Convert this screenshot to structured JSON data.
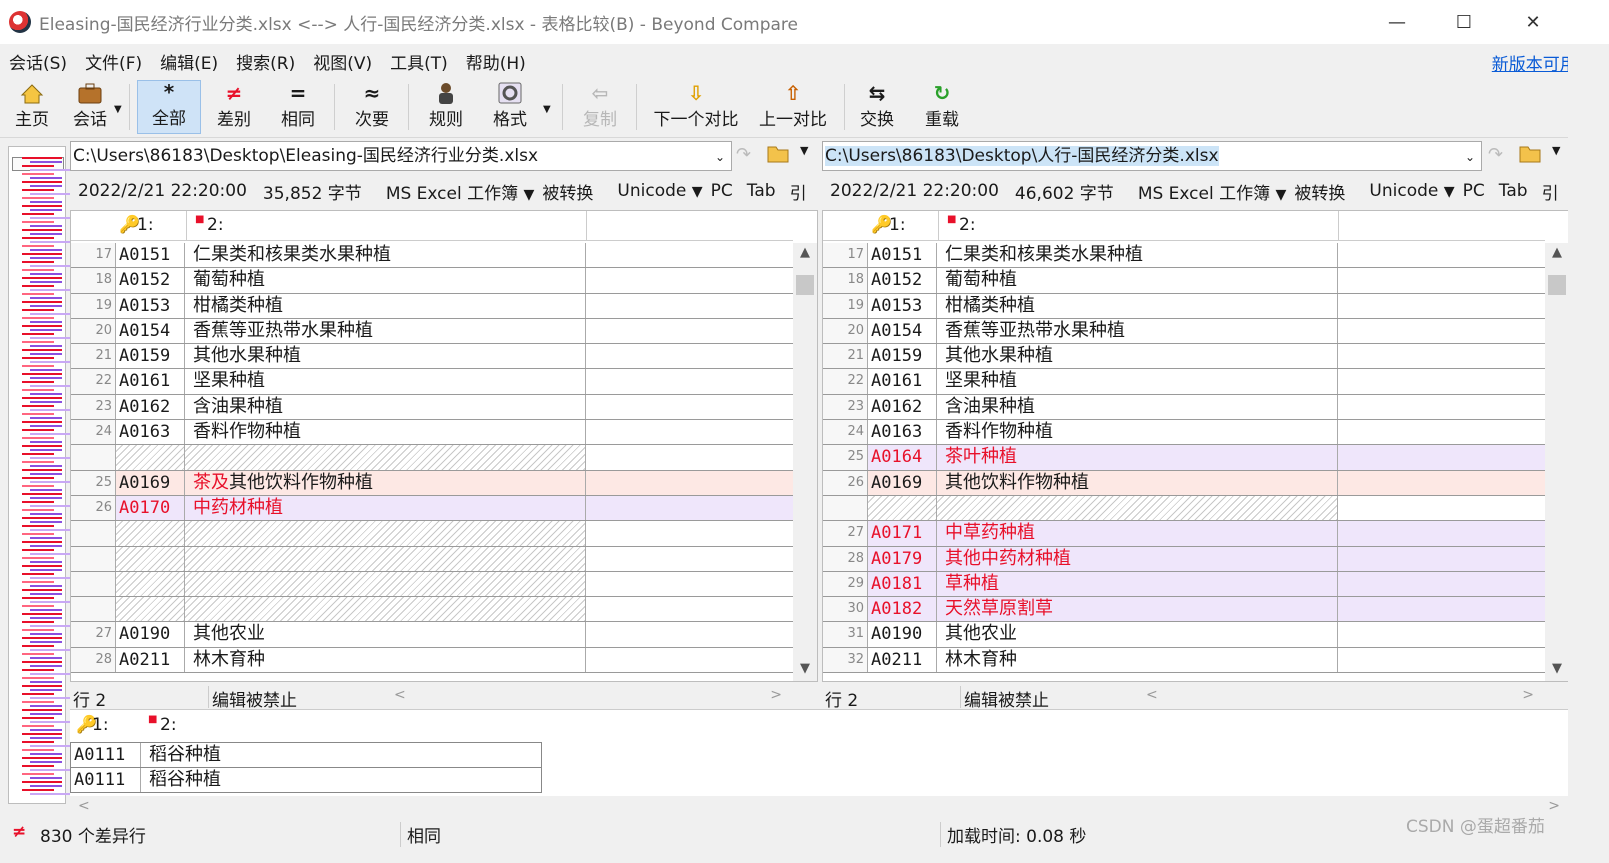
{
  "window": {
    "title": "Eleasing-国民经济行业分类.xlsx <--> 人行-国民经济分类.xlsx - 表格比较(B) - Beyond Compare"
  },
  "menu": [
    "会话(S)",
    "文件(F)",
    "编辑(E)",
    "搜索(R)",
    "视图(V)",
    "工具(T)",
    "帮助(H)"
  ],
  "update_link": "新版本可用...",
  "toolbar": {
    "home": "主页",
    "session": "会话",
    "all": "全部",
    "diffs": "差别",
    "same": "相同",
    "minor": "次要",
    "rules": "规则",
    "format": "格式",
    "copy": "复制",
    "next_diff": "下一个对比",
    "prev_diff": "上一对比",
    "swap": "交换",
    "reload": "重载"
  },
  "left": {
    "path": "C:\\Users\\86183\\Desktop\\Eleasing-国民经济行业分类.xlsx",
    "info": {
      "date": "2022/2/21 22:20:00",
      "size": "35,852 字节",
      "type": "MS Excel 工作簿",
      "conv": "被转换",
      "enc": "Unicode",
      "eol": "PC",
      "tab": "Tab",
      "quote": "引"
    },
    "col1": "1:",
    "col2": "2:",
    "rows": [
      {
        "ln": "17",
        "code": "A0151",
        "name": "仁果类和核果类水果种植",
        "state": "same"
      },
      {
        "ln": "18",
        "code": "A0152",
        "name": "葡萄种植",
        "state": "same"
      },
      {
        "ln": "19",
        "code": "A0153",
        "name": "柑橘类种植",
        "state": "same"
      },
      {
        "ln": "20",
        "code": "A0154",
        "name": "香蕉等亚热带水果种植",
        "state": "same"
      },
      {
        "ln": "21",
        "code": "A0159",
        "name": "其他水果种植",
        "state": "same"
      },
      {
        "ln": "22",
        "code": "A0161",
        "name": "坚果种植",
        "state": "same"
      },
      {
        "ln": "23",
        "code": "A0162",
        "name": "含油果种植",
        "state": "same"
      },
      {
        "ln": "24",
        "code": "A0163",
        "name": "香料作物种植",
        "state": "same"
      },
      {
        "ln": "",
        "code": "",
        "name": "",
        "state": "gap"
      },
      {
        "ln": "25",
        "code": "A0169",
        "name_red": "茶及",
        "name": "其他饮料作物种植",
        "state": "diff"
      },
      {
        "ln": "26",
        "code": "A0170",
        "name": "中药材种植",
        "state": "orphan"
      },
      {
        "ln": "",
        "code": "",
        "name": "",
        "state": "gap"
      },
      {
        "ln": "",
        "code": "",
        "name": "",
        "state": "gap"
      },
      {
        "ln": "",
        "code": "",
        "name": "",
        "state": "gap"
      },
      {
        "ln": "",
        "code": "",
        "name": "",
        "state": "gap"
      },
      {
        "ln": "27",
        "code": "A0190",
        "name": "其他农业",
        "state": "same"
      },
      {
        "ln": "28",
        "code": "A0211",
        "name": "林木育种",
        "state": "same"
      }
    ],
    "status_line": "行 2",
    "status_edit": "编辑被禁止"
  },
  "right": {
    "path": "C:\\Users\\86183\\Desktop\\人行-国民经济分类.xlsx",
    "info": {
      "date": "2022/2/21 22:20:00",
      "size": "46,602 字节",
      "type": "MS Excel 工作簿",
      "conv": "被转换",
      "enc": "Unicode",
      "eol": "PC",
      "tab": "Tab",
      "quote": "引"
    },
    "col1": "1:",
    "col2": "2:",
    "rows": [
      {
        "ln": "17",
        "code": "A0151",
        "name": "仁果类和核果类水果种植",
        "state": "same"
      },
      {
        "ln": "18",
        "code": "A0152",
        "name": "葡萄种植",
        "state": "same"
      },
      {
        "ln": "19",
        "code": "A0153",
        "name": "柑橘类种植",
        "state": "same"
      },
      {
        "ln": "20",
        "code": "A0154",
        "name": "香蕉等亚热带水果种植",
        "state": "same"
      },
      {
        "ln": "21",
        "code": "A0159",
        "name": "其他水果种植",
        "state": "same"
      },
      {
        "ln": "22",
        "code": "A0161",
        "name": "坚果种植",
        "state": "same"
      },
      {
        "ln": "23",
        "code": "A0162",
        "name": "含油果种植",
        "state": "same"
      },
      {
        "ln": "24",
        "code": "A0163",
        "name": "香料作物种植",
        "state": "same"
      },
      {
        "ln": "25",
        "code": "A0164",
        "name": "茶叶种植",
        "state": "orphan"
      },
      {
        "ln": "26",
        "code": "A0169",
        "name": "其他饮料作物种植",
        "state": "diff"
      },
      {
        "ln": "",
        "code": "",
        "name": "",
        "state": "gap"
      },
      {
        "ln": "27",
        "code": "A0171",
        "name": "中草药种植",
        "state": "orphan"
      },
      {
        "ln": "28",
        "code": "A0179",
        "name": "其他中药材种植",
        "state": "orphan"
      },
      {
        "ln": "29",
        "code": "A0181",
        "name": "草种植",
        "state": "orphan"
      },
      {
        "ln": "30",
        "code": "A0182",
        "name": "天然草原割草",
        "state": "orphan"
      },
      {
        "ln": "31",
        "code": "A0190",
        "name": "其他农业",
        "state": "same"
      },
      {
        "ln": "32",
        "code": "A0211",
        "name": "林木育种",
        "state": "same"
      }
    ],
    "status_line": "行 2",
    "status_edit": "编辑被禁止"
  },
  "detail": {
    "col1": "1:",
    "col2": "2:",
    "rows": [
      {
        "code": "A0111",
        "name": "稻谷种植"
      },
      {
        "code": "A0111",
        "name": "稻谷种植"
      }
    ]
  },
  "statusbar": {
    "diff_count": "830 个差异行",
    "mode": "相同",
    "load_time": "加载时间: 0.08 秒"
  },
  "watermark": "CSDN @蛋超番茄",
  "colors": {
    "diff_bg": "#fde8e4",
    "orphan_bg": "#efe6fb",
    "diff_text": "#e8102a",
    "active_btn": "#cfe3f7",
    "link": "#0a5bd6"
  }
}
